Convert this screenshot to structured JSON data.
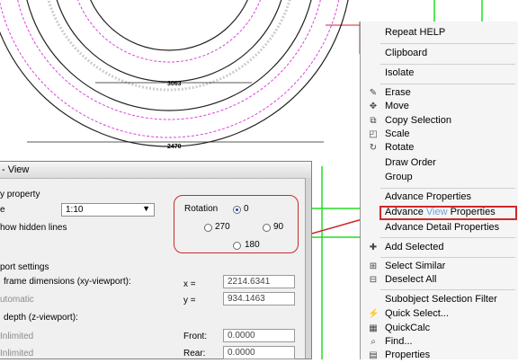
{
  "drawing": {
    "dim_outer": "3063",
    "dim_inner": "2470"
  },
  "dialog": {
    "title": "- View",
    "view_property": "y property",
    "scale_label": "e",
    "scale_value": "1:10",
    "hidden_lines": "how hidden lines",
    "rotation": {
      "label": "Rotation",
      "options": [
        "0",
        "270",
        "90",
        "180"
      ],
      "selected": "0"
    },
    "viewport_settings": "port settings",
    "frame_dimensions": "frame dimensions (xy-viewport):",
    "automatic": "utomatic",
    "x_label": "x =",
    "x_value": "2214.6341",
    "y_label": "y =",
    "y_value": "934.1463",
    "depth": "depth (z-viewport):",
    "unlimited1": "Inlimited",
    "front_label": "Front:",
    "front_value": "0.0000",
    "unlimited2": "Inlimited",
    "rear_label": "Rear:",
    "rear_value": "0.0000"
  },
  "menu": {
    "items": [
      {
        "label": "Repeat HELP",
        "icon": ""
      },
      {
        "label": "Clipboard",
        "icon": ""
      },
      {
        "label": "Isolate",
        "icon": ""
      },
      {
        "label": "Erase",
        "icon": "eraser-icon"
      },
      {
        "label": "Move",
        "icon": "move-icon"
      },
      {
        "label": "Copy Selection",
        "icon": "copy-icon"
      },
      {
        "label": "Scale",
        "icon": "scale-icon"
      },
      {
        "label": "Rotate",
        "icon": "rotate-icon"
      },
      {
        "label": "Draw Order",
        "icon": ""
      },
      {
        "label": "Group",
        "icon": ""
      },
      {
        "label": "Advance Properties",
        "icon": ""
      },
      {
        "label_pre": "Advance ",
        "label_hl": "View",
        "label_post": " Properties",
        "icon": ""
      },
      {
        "label": "Advance Detail Properties",
        "icon": ""
      },
      {
        "label": "Add Selected",
        "icon": "add-selected-icon"
      },
      {
        "label": "Select Similar",
        "icon": "select-similar-icon"
      },
      {
        "label": "Deselect All",
        "icon": "deselect-icon"
      },
      {
        "label": "Subobject Selection Filter",
        "icon": ""
      },
      {
        "label": "Quick Select...",
        "icon": "quick-select-icon"
      },
      {
        "label": "QuickCalc",
        "icon": "calculator-icon"
      },
      {
        "label": "Find...",
        "icon": "find-icon"
      },
      {
        "label": "Properties",
        "icon": "properties-icon"
      }
    ]
  },
  "colors": {
    "highlight_red": "#cc2a2a",
    "dash_magenta": "#e040e0",
    "green_line": "#22dd22"
  }
}
